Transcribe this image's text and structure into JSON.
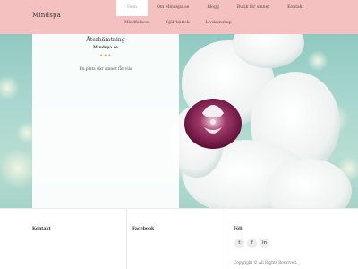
{
  "header": {
    "brand": "Mindspa",
    "nav_row1": [
      {
        "label": "Hem",
        "active": true
      },
      {
        "label": "Om Mindspa.se",
        "active": false
      },
      {
        "label": "Blogg",
        "active": false
      },
      {
        "label": "Butik för sinnet",
        "active": false
      },
      {
        "label": "Kontakt",
        "active": false
      }
    ],
    "nav_row2": [
      {
        "label": "Mindfulness"
      },
      {
        "label": "Självkärlek"
      },
      {
        "label": "Livskunskap"
      }
    ]
  },
  "hero": {
    "title": "Återhämtning",
    "subtitle": "Mindspa.se",
    "stars": "★★★",
    "tagline": "En plats där sinnet får vila"
  },
  "footer": {
    "contact_heading": "Kontakt",
    "facebook_heading": "Facebook",
    "follow_heading": "Följ",
    "socials": [
      {
        "icon": "twitter-icon",
        "glyph": "t"
      },
      {
        "icon": "facebook-icon",
        "glyph": "f"
      },
      {
        "icon": "linkedin-icon",
        "glyph": "in"
      }
    ],
    "copyright": "Copyright © All Rights Reserved."
  },
  "colors": {
    "header_bg": "#f4c0c0",
    "hero_teal": "#a9d7cf",
    "orchid_purple": "#7a1444"
  }
}
